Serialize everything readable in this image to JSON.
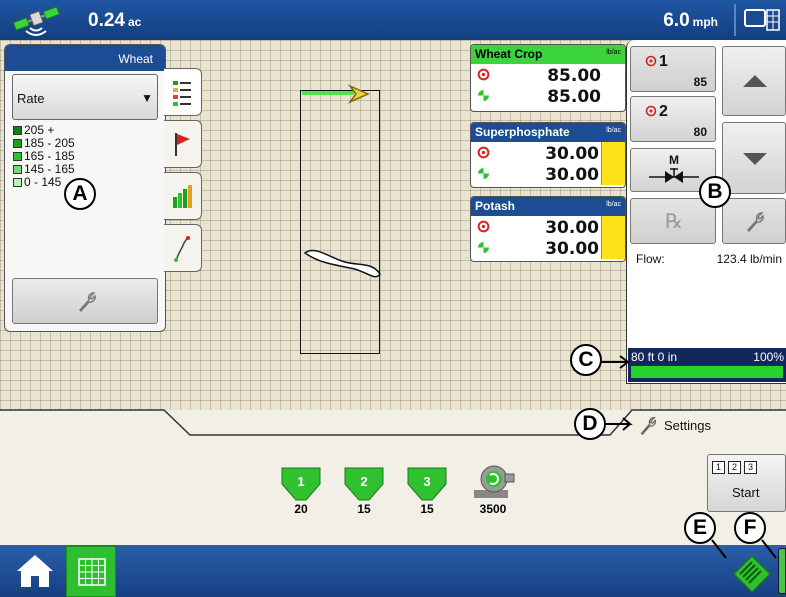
{
  "topbar": {
    "area_value": "0.24",
    "area_unit": "ac",
    "speed_value": "6.0",
    "speed_unit": "mph",
    "gps_icon": "satellite-gps-icon",
    "display_icon": "screen-layout-icon"
  },
  "legend": {
    "title": "Wheat",
    "dropdown_value": "Rate",
    "dropdown_arrow": "▼",
    "ranges": [
      {
        "label": "205 +",
        "color": "#167d16"
      },
      {
        "label": "185 - 205",
        "color": "#1f9e1f"
      },
      {
        "label": "165 - 185",
        "color": "#2fc12f"
      },
      {
        "label": "145 - 165",
        "color": "#70dd70"
      },
      {
        "label": "0 - 145",
        "color": "#b8f2b8"
      }
    ],
    "tabs": [
      "legend-list-icon",
      "flag-icon",
      "yield-bars-icon",
      "guidance-path-icon"
    ],
    "wrench_icon": "wrench-icon"
  },
  "products": [
    {
      "name": "Wheat Crop",
      "unit": "lb/ac",
      "target": "85.00",
      "actual": "85.00"
    },
    {
      "name": "Superphosphate",
      "unit": "lb/ac",
      "target": "30.00",
      "actual": "30.00"
    },
    {
      "name": "Potash",
      "unit": "lb/ac",
      "target": "30.00",
      "actual": "30.00"
    }
  ],
  "controls": {
    "preset1_number": "1",
    "preset1_value": "85",
    "preset2_number": "2",
    "preset2_value": "80",
    "manual_label": "M",
    "rx_label": "℞",
    "flow_label": "Flow:",
    "flow_value": "123.4 lb/min",
    "implement_width": "80 ft 0 in",
    "implement_percent": "100%",
    "implement_fraction": 1.0
  },
  "callouts": [
    "A",
    "B",
    "C",
    "D",
    "E",
    "F"
  ],
  "settings_label": "Settings",
  "bins": [
    {
      "number": "1",
      "value": "20"
    },
    {
      "number": "2",
      "value": "15"
    },
    {
      "number": "3",
      "value": "15"
    }
  ],
  "pump_value": "3500",
  "start": {
    "squares": [
      "1",
      "2",
      "3"
    ],
    "label": "Start"
  },
  "colors": {
    "accent_blue": "#1c4c93",
    "accent_green": "#3cd43c",
    "yellow": "#fde21a"
  }
}
